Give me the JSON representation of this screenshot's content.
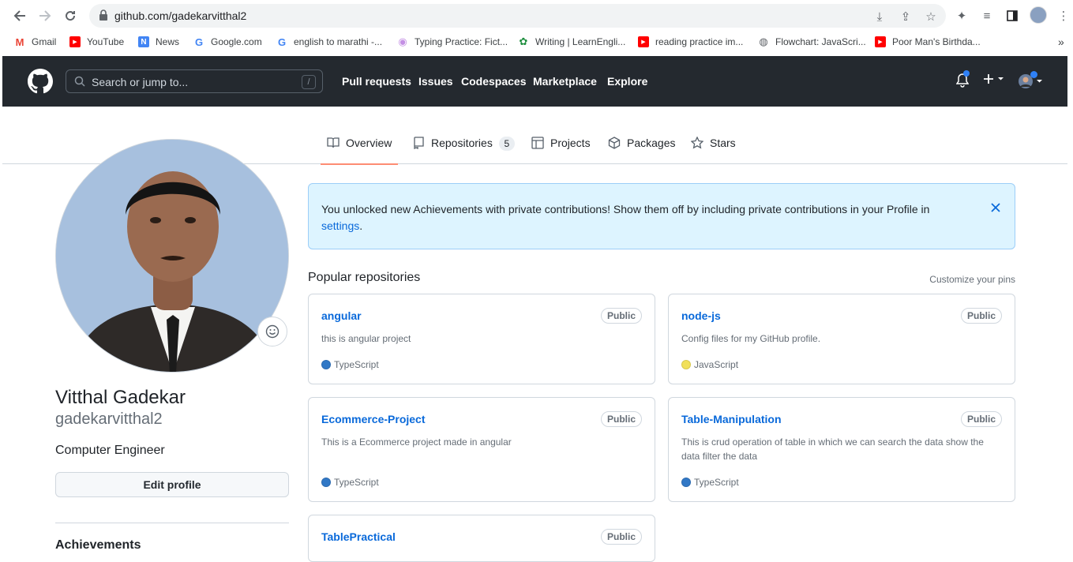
{
  "browser": {
    "url": "github.com/gadekarvitthal2",
    "bookmarks": [
      {
        "label": "Gmail",
        "icon": "gmail-icon",
        "color": "#ea4335",
        "glyph": "M"
      },
      {
        "label": "YouTube",
        "icon": "youtube-icon",
        "color": "#ff0000",
        "glyph": "▶"
      },
      {
        "label": "News",
        "icon": "news-icon",
        "color": "#4285f4",
        "glyph": "N"
      },
      {
        "label": "Google.com",
        "icon": "google-icon",
        "color": "#4285f4",
        "glyph": "G"
      },
      {
        "label": "english to marathi -...",
        "icon": "google-icon",
        "color": "#4285f4",
        "glyph": "G"
      },
      {
        "label": "Typing Practice: Fict...",
        "icon": "typing-icon",
        "color": "#c490e4",
        "glyph": "◉"
      },
      {
        "label": "Writing | LearnEngli...",
        "icon": "learnenglish-icon",
        "color": "#1e8e3e",
        "glyph": "✿"
      },
      {
        "label": "reading practice im...",
        "icon": "youtube-icon",
        "color": "#ff0000",
        "glyph": "▶"
      },
      {
        "label": "Flowchart: JavaScri...",
        "icon": "globe-icon",
        "color": "#5f6368",
        "glyph": "◍"
      },
      {
        "label": "Poor Man's Birthda...",
        "icon": "youtube-icon",
        "color": "#ff0000",
        "glyph": "▶"
      }
    ],
    "more": "»"
  },
  "header": {
    "search_placeholder": "Search or jump to...",
    "slash": "/",
    "nav": [
      "Pull requests",
      "Issues",
      "Codespaces",
      "Marketplace",
      "Explore"
    ]
  },
  "tabs": [
    {
      "label": "Overview",
      "icon": "book-icon",
      "glyph": "📖"
    },
    {
      "label": "Repositories",
      "icon": "repo-icon",
      "glyph": "▭",
      "count": "5"
    },
    {
      "label": "Projects",
      "icon": "table-icon",
      "glyph": "▦"
    },
    {
      "label": "Packages",
      "icon": "package-icon",
      "glyph": "⬡"
    },
    {
      "label": "Stars",
      "icon": "star-icon",
      "glyph": "☆"
    }
  ],
  "profile": {
    "fullname": "Vitthal Gadekar",
    "username": "gadekarvitthal2",
    "bio": "Computer Engineer",
    "edit_label": "Edit profile",
    "achievements_title": "Achievements"
  },
  "flash": {
    "message": "You unlocked new Achievements with private contributions! Show them off by including private contributions in your Profile in",
    "link": "settings",
    "period": "."
  },
  "popular": {
    "title": "Popular repositories",
    "customize": "Customize your pins",
    "repos": [
      {
        "name": "angular",
        "visibility": "Public",
        "description": "this is angular project",
        "language": "TypeScript",
        "lang_color": "#3178c6"
      },
      {
        "name": "node-js",
        "visibility": "Public",
        "description": "Config files for my GitHub profile.",
        "language": "JavaScript",
        "lang_color": "#f1e05a"
      },
      {
        "name": "Ecommerce-Project",
        "visibility": "Public",
        "description": "This is a Ecommerce project made in angular",
        "language": "TypeScript",
        "lang_color": "#3178c6"
      },
      {
        "name": "Table-Manipulation",
        "visibility": "Public",
        "description": "This is crud operation of table in which we can search the data show the data filter the data",
        "language": "TypeScript",
        "lang_color": "#3178c6"
      },
      {
        "name": "TablePractical",
        "visibility": "Public",
        "description": "",
        "language": "",
        "lang_color": "#3178c6"
      }
    ]
  }
}
